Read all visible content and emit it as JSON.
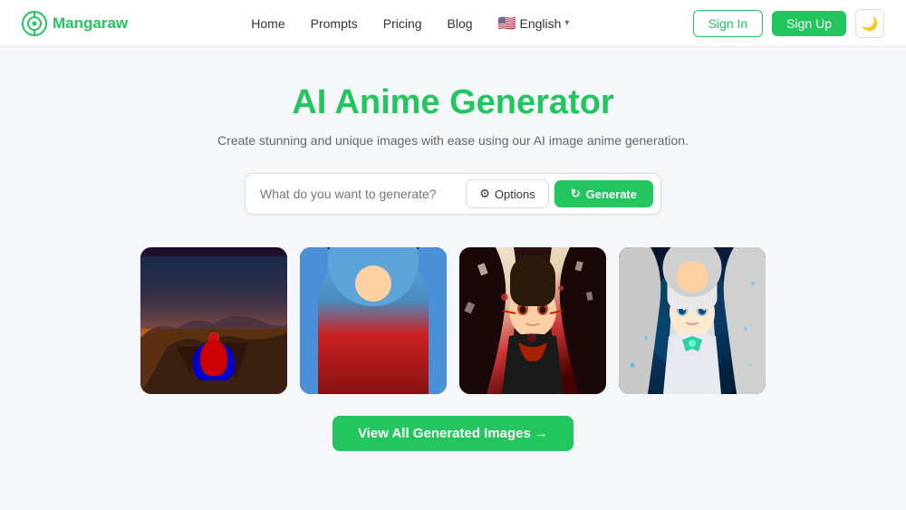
{
  "app": {
    "name": "Mangaraw",
    "logo_alt": "Mangaraw logo"
  },
  "nav": {
    "links": [
      {
        "label": "Home",
        "id": "home"
      },
      {
        "label": "Prompts",
        "id": "prompts"
      },
      {
        "label": "Pricing",
        "id": "pricing"
      },
      {
        "label": "Blog",
        "id": "blog"
      }
    ],
    "language": {
      "label": "English",
      "flag": "🇺🇸"
    }
  },
  "header_actions": {
    "signin_label": "Sign In",
    "signup_label": "Sign Up",
    "theme_icon": "🌙"
  },
  "hero": {
    "title": "AI Anime Generator",
    "subtitle": "Create stunning and unique images with ease using our AI image anime generation."
  },
  "generator": {
    "input_placeholder": "What do you want to generate?",
    "options_label": "Options",
    "generate_label": "Generate"
  },
  "gallery": {
    "images": [
      {
        "id": "img1",
        "alt": "Spider-Man sitting on cliff edge with canyon view"
      },
      {
        "id": "img2",
        "alt": "Anime girl with long blue hair in red outfit"
      },
      {
        "id": "img3",
        "alt": "Dark anime samurai character with red markings"
      },
      {
        "id": "img4",
        "alt": "Anime girl with long silver hair and ornate armor"
      }
    ]
  },
  "view_all": {
    "label": "View All Generated Images →"
  }
}
